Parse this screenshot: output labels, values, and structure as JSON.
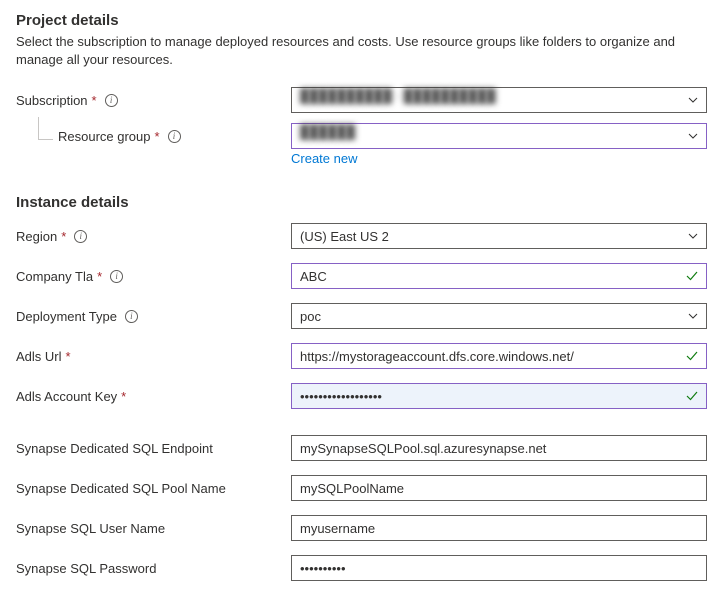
{
  "project": {
    "heading": "Project details",
    "desc": "Select the subscription to manage deployed resources and costs. Use resource groups like folders to organize and manage all your resources.",
    "subscription_label": "Subscription",
    "subscription_value": "██████████ · ██████████",
    "resource_group_label": "Resource group",
    "resource_group_value": "██████",
    "create_new": "Create new"
  },
  "instance": {
    "heading": "Instance details",
    "region_label": "Region",
    "region_value": "(US) East US 2",
    "company_tla_label": "Company Tla",
    "company_tla_value": "ABC",
    "deployment_type_label": "Deployment Type",
    "deployment_type_value": "poc",
    "adls_url_label": "Adls Url",
    "adls_url_value": "https://mystorageaccount.dfs.core.windows.net/",
    "adls_key_label": "Adls Account Key",
    "adls_key_value": "••••••••••••••••••",
    "syn_endpoint_label": "Synapse Dedicated SQL Endpoint",
    "syn_endpoint_value": "mySynapseSQLPool.sql.azuresynapse.net",
    "syn_pool_label": "Synapse Dedicated SQL Pool Name",
    "syn_pool_value": "mySQLPoolName",
    "syn_user_label": "Synapse SQL User Name",
    "syn_user_value": "myusername",
    "syn_pass_label": "Synapse SQL Password",
    "syn_pass_value": "••••••••••"
  }
}
